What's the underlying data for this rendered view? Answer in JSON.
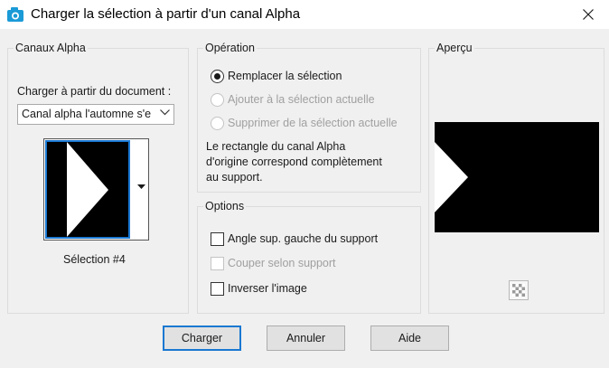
{
  "window": {
    "title": "Charger la sélection à partir d'un canal Alpha"
  },
  "canaux": {
    "legend": "Canaux Alpha",
    "load_from_label": "Charger à partir du document :",
    "document_value": "Canal alpha l'automne s'e",
    "selection_caption": "Sélection #4"
  },
  "operation": {
    "legend": "Opération",
    "options": [
      {
        "label": "Remplacer la sélection",
        "selected": true,
        "enabled": true
      },
      {
        "label": "Ajouter à la sélection actuelle",
        "selected": false,
        "enabled": false
      },
      {
        "label": "Supprimer de la sélection actuelle",
        "selected": false,
        "enabled": false
      }
    ],
    "description_lines": [
      "Le rectangle du canal Alpha",
      "d'origine correspond complètement",
      "au support."
    ]
  },
  "options": {
    "legend": "Options",
    "checkboxes": [
      {
        "label": "Angle sup. gauche du support",
        "checked": false,
        "enabled": true
      },
      {
        "label": "Couper selon support",
        "checked": false,
        "enabled": false
      },
      {
        "label": "Inverser l'image",
        "checked": false,
        "enabled": true
      }
    ]
  },
  "apercu": {
    "legend": "Aperçu"
  },
  "buttons": {
    "load": "Charger",
    "cancel": "Annuler",
    "help": "Aide"
  },
  "colors": {
    "accent": "#1a78d2",
    "dialog_bg": "#f0f0f0",
    "disabled_text": "#a0a0a0"
  }
}
